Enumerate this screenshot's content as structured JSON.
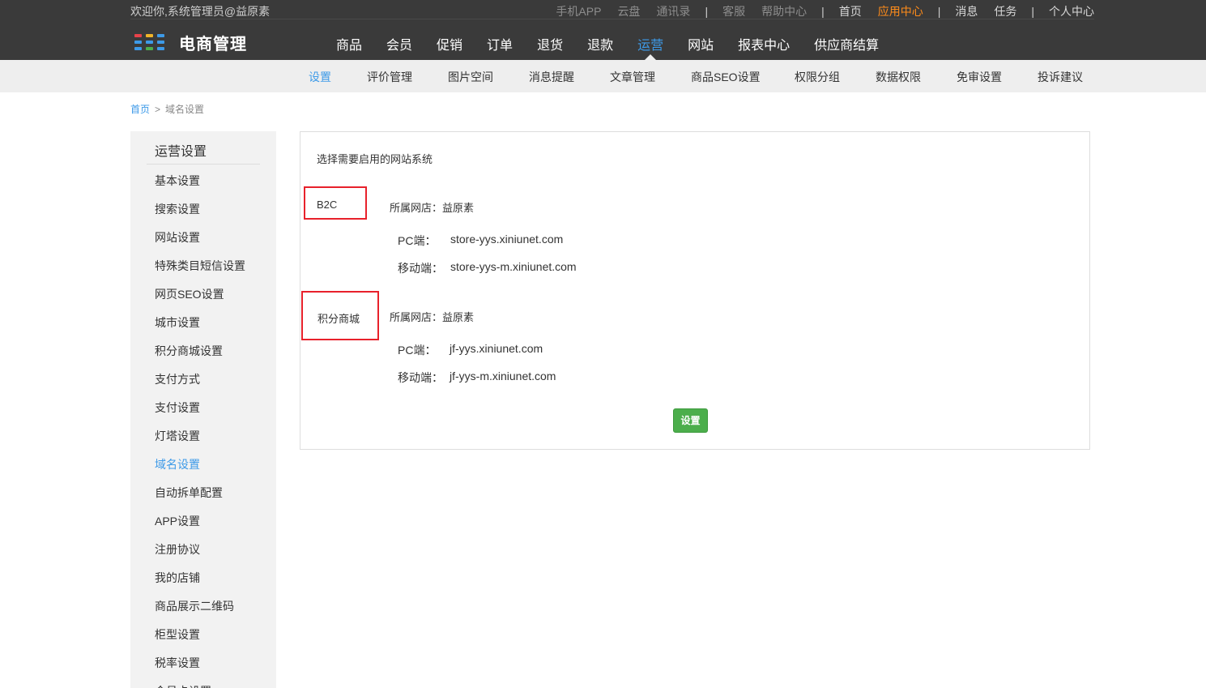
{
  "header": {
    "welcome": "欢迎你,系统管理员@益原素",
    "top_links": [
      {
        "label": "手机APP",
        "style": "dim"
      },
      {
        "label": "云盘",
        "style": "dim"
      },
      {
        "label": "通讯录",
        "style": "dim"
      },
      {
        "label": "客服",
        "style": "dim",
        "sep_before": true
      },
      {
        "label": "帮助中心",
        "style": "dim"
      },
      {
        "label": "首页",
        "style": "bright",
        "sep_before": true
      },
      {
        "label": "应用中心",
        "style": "active"
      },
      {
        "label": "消息",
        "style": "bright",
        "sep_before": true
      },
      {
        "label": "任务",
        "style": "bright"
      },
      {
        "label": "个人中心",
        "style": "bright",
        "sep_before": true
      }
    ],
    "logo_icon": "grid-logo-icon",
    "logo_text": "电商管理",
    "main_nav": [
      "商品",
      "会员",
      "促销",
      "订单",
      "退货",
      "退款",
      "运营",
      "网站",
      "报表中心",
      "供应商结算"
    ],
    "main_nav_active": "运营"
  },
  "subnav": {
    "items": [
      "设置",
      "评价管理",
      "图片空间",
      "消息提醒",
      "文章管理",
      "商品SEO设置",
      "权限分组",
      "数据权限",
      "免审设置",
      "投诉建议"
    ],
    "active": "设置"
  },
  "breadcrumb": {
    "home": "首页",
    "separator": ">",
    "current": "域名设置"
  },
  "sidebar": {
    "title": "运营设置",
    "items": [
      "基本设置",
      "搜索设置",
      "网站设置",
      "特殊类目短信设置",
      "网页SEO设置",
      "城市设置",
      "积分商城设置",
      "支付方式",
      "支付设置",
      "灯塔设置",
      "域名设置",
      "自动拆单配置",
      "APP设置",
      "注册协议",
      "我的店铺",
      "商品展示二维码",
      "柜型设置",
      "税率设置",
      "会员卡设置"
    ],
    "active": "域名设置"
  },
  "content": {
    "heading": "选择需要启用的网站系统",
    "systems": [
      {
        "name": "B2C",
        "store": "所属网店：益原素",
        "pc_label": "PC端：",
        "pc_url": "store-yys.xiniunet.com",
        "mobile_label": "移动端：",
        "mobile_url": "store-yys-m.xiniunet.com"
      },
      {
        "name": "积分商城",
        "store": "所属网店：益原素",
        "pc_label": "PC端：",
        "pc_url": "jf-yys.xiniunet.com",
        "mobile_label": "移动端：",
        "mobile_url": "jf-yys-m.xiniunet.com"
      }
    ],
    "button_label": "设置"
  },
  "colors": {
    "header_bg": "#3a3a3a",
    "accent_blue": "#3d9ae8",
    "accent_orange": "#ff8c1a",
    "highlight_red": "#e8212b",
    "button_green": "#4cae4c"
  }
}
